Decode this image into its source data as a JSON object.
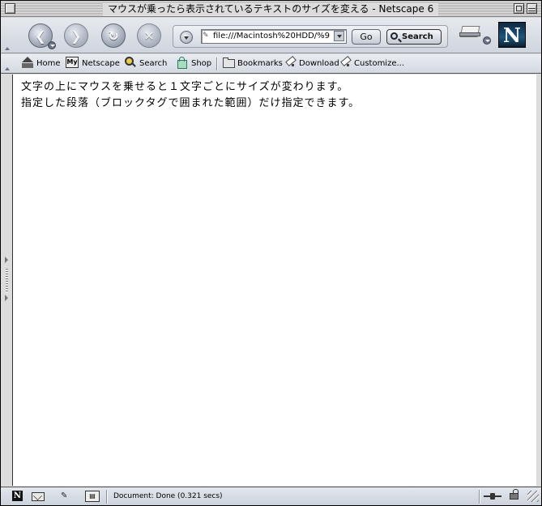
{
  "window": {
    "title": "マウスが乗ったら表示されているテキストのサイズを変える - Netscape 6"
  },
  "navigation": {
    "url": "file:///Macintosh%20HDD/%9",
    "go_label": "Go",
    "search_label": "Search",
    "logo_letter": "N"
  },
  "personal_toolbar": {
    "items": [
      {
        "label": "Home",
        "icon": "home-icon"
      },
      {
        "label": "Netscape",
        "icon": "my-netscape-icon"
      },
      {
        "label": "Search",
        "icon": "search-icon"
      },
      {
        "label": "Shop",
        "icon": "shop-icon"
      },
      {
        "label": "Bookmarks",
        "icon": "bookmarks-folder-icon"
      },
      {
        "label": "Download",
        "icon": "bookmark-icon"
      },
      {
        "label": "Customize...",
        "icon": "bookmark-icon"
      }
    ],
    "my_badge": "My"
  },
  "content": {
    "lines": [
      "文字の上にマウスを乗せると１文字ごとにサイズが変わります。",
      "指定した段落（ブロックタグで囲まれた範囲）だけ指定できます。"
    ]
  },
  "status": {
    "text": "Document: Done (0.321 secs)",
    "component_glyph": "N"
  }
}
